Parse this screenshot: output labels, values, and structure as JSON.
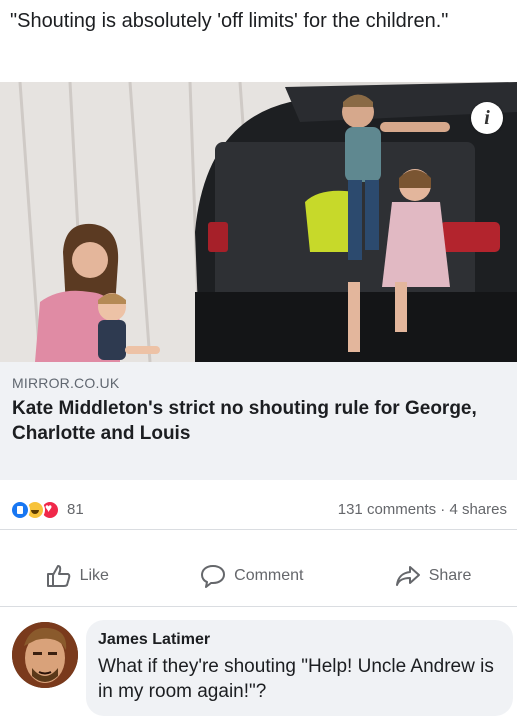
{
  "post": {
    "text": "\"Shouting is absolutely 'off limits' for the children.\""
  },
  "link_card": {
    "domain": "MIRROR.CO.UK",
    "headline": "Kate Middleton's strict no shouting rule for George, Charlotte and Louis",
    "info_glyph": "i"
  },
  "stats": {
    "reaction_icons": [
      "like-icon",
      "haha-icon",
      "love-icon"
    ],
    "reaction_count": "81",
    "comments_shares": "131 comments · 4 shares"
  },
  "actions": {
    "like": "Like",
    "comment": "Comment",
    "share": "Share"
  },
  "comment": {
    "author": "James Latimer",
    "text": "What if they're shouting \"Help! Uncle Andrew is in my room again!\"?"
  },
  "colors": {
    "link_meta_bg": "#f0f2f5",
    "like_blue": "#1877f2",
    "muted_text": "#65676b"
  }
}
